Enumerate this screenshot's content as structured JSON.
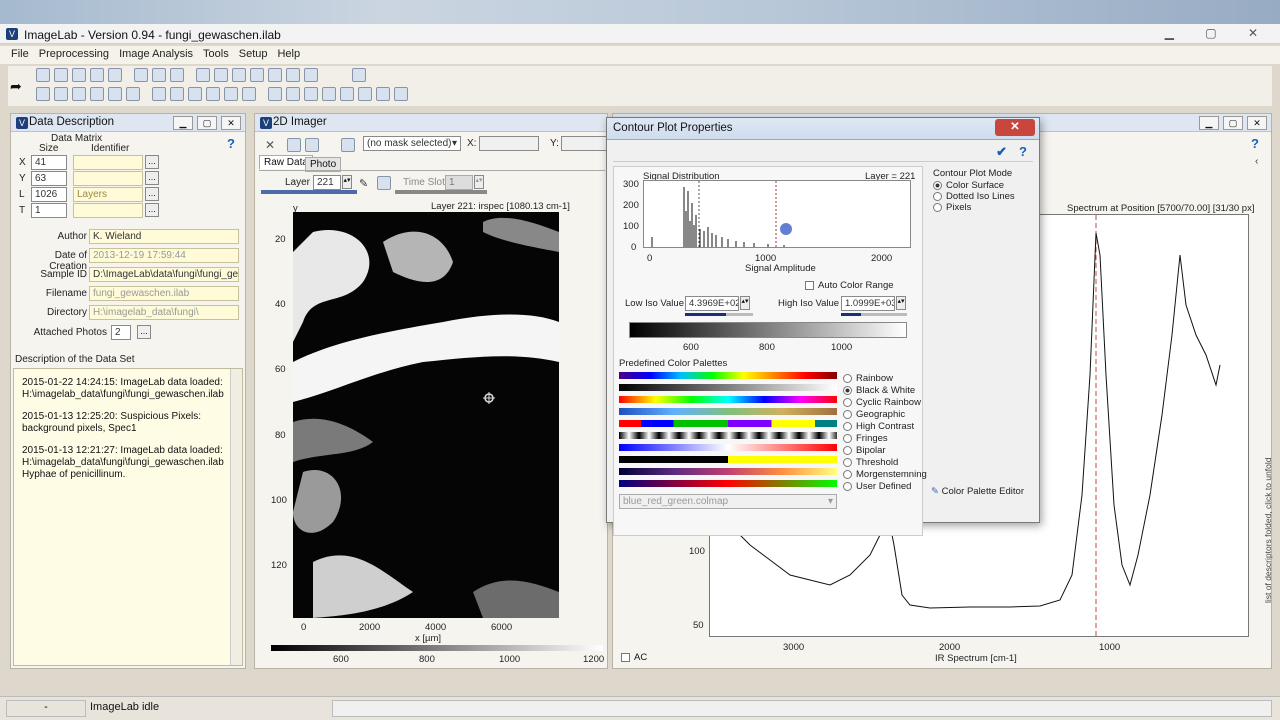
{
  "window": {
    "title": "ImageLab - Version 0.94 - fungi_gewaschen.ilab"
  },
  "menu": [
    "File",
    "Preprocessing",
    "Image Analysis",
    "Tools",
    "Setup",
    "Help"
  ],
  "data_description": {
    "title": "Data Description",
    "matrix_header": "Data Matrix",
    "size_header": "Size",
    "identifier_header": "Identifier",
    "rows": [
      {
        "axis": "X",
        "size": "41",
        "identifier": ""
      },
      {
        "axis": "Y",
        "size": "63",
        "identifier": ""
      },
      {
        "axis": "L",
        "size": "1026",
        "identifier": "Layers"
      },
      {
        "axis": "T",
        "size": "1",
        "identifier": ""
      }
    ],
    "author_label": "Author",
    "author": "K. Wieland",
    "date_label": "Date of Creation",
    "date": "2013-12-19 17:59:44",
    "sample_label": "Sample ID",
    "sample": "D:\\ImageLab\\data\\fungi\\fungi_gewas",
    "filename_label": "Filename",
    "filename": "fungi_gewaschen.ilab",
    "directory_label": "Directory",
    "directory": "H:\\imagelab_data\\fungi\\",
    "photos_label": "Attached Photos",
    "photos": "2",
    "desc_header": "Description of the Data Set",
    "log": [
      "2015-01-22 14:24:15: ImageLab data loaded: H:\\imagelab_data\\fungi\\fungi_gewaschen.ilab",
      "2015-01-13 12:25:20: Suspicious Pixels: background pixels, Spec1",
      "2015-01-13 12:21:27: ImageLab data loaded: H:\\imagelab_data\\fungi\\fungi_gewaschen.ilab Hyphae of penicillinum."
    ]
  },
  "imager": {
    "title": "2D Imager",
    "mask": "(no mask selected)",
    "x_label": "X:",
    "y_label": "Y:",
    "tab_raw": "Raw Data",
    "tab_photo": "Photo",
    "layer_label": "Layer",
    "layer": "221",
    "timeslot_label": "Time Slot",
    "timeslot": "1",
    "image_title": "Layer 221: irspec [1080.13 cm-1]",
    "y_axis": "y",
    "y_ticks": [
      "20",
      "40",
      "60",
      "80",
      "100",
      "120"
    ],
    "x_ticks": [
      "0",
      "2000",
      "4000",
      "6000"
    ],
    "x_axis": "x [µm]",
    "cbar_ticks": [
      "600",
      "800",
      "1000",
      "1200"
    ],
    "ac": "AC"
  },
  "spectrum": {
    "title": "Spectrum at Position [5700/70.00] [31/30 px]",
    "y_ticks": [
      "100",
      "50"
    ],
    "x_ticks": [
      "3000",
      "2000",
      "1000"
    ],
    "x_axis": "IR Spectrum [cm-1]",
    "side_text": "list of descriptors folded, click to unfold"
  },
  "dialog": {
    "title": "Contour Plot Properties",
    "hist_title": "Signal Distribution",
    "layer": "Layer = 221",
    "hist_y_ticks": [
      "300",
      "200",
      "100",
      "0"
    ],
    "hist_x_ticks": [
      "0",
      "1000",
      "2000"
    ],
    "hist_xlabel": "Signal Amplitude",
    "auto_range": "Auto Color Range",
    "low_label": "Low Iso Value",
    "low": "4.3969E+02",
    "high_label": "High Iso Value",
    "high": "1.0999E+03",
    "grad_ticks": [
      "600",
      "800",
      "1000"
    ],
    "mode_header": "Contour Plot Mode",
    "modes": [
      "Color Surface",
      "Dotted Iso Lines",
      "Pixels"
    ],
    "pal_header": "Predefined Color Palettes",
    "palettes": [
      "Rainbow",
      "Black & White",
      "Cyclic Rainbow",
      "Geographic",
      "High Contrast",
      "Fringes",
      "Bipolar",
      "Threshold",
      "Morgenstemning",
      "User Defined"
    ],
    "colormap": "blue_red_green.colmap",
    "editor": "Color Palette Editor"
  },
  "status": {
    "left": "-",
    "text": "ImageLab idle"
  }
}
